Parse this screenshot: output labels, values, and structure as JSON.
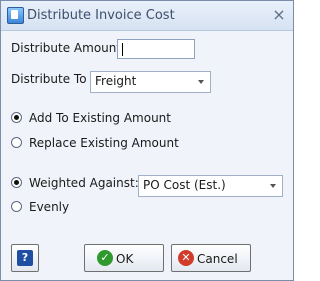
{
  "window": {
    "title": "Distribute Invoice Cost",
    "close_glyph": "×"
  },
  "form": {
    "distribute_amount_label": "Distribute Amount",
    "distribute_amount_value": "",
    "distribute_to_label": "Distribute To",
    "distribute_to_value": "Freight",
    "add_to_existing_label": "Add To Existing Amount",
    "replace_existing_label": "Replace Existing Amount",
    "weighted_against_label": "Weighted Against:",
    "weighted_against_value": "PO Cost (Est.)",
    "evenly_label": "Evenly",
    "selected_mode": "Add To Existing Amount",
    "selected_weighting": "Weighted Against:"
  },
  "buttons": {
    "help_glyph": "?",
    "ok_label": "OK",
    "cancel_label": "Cancel"
  },
  "colors": {
    "ok_icon": "#2e9a2e",
    "cancel_icon": "#d23a2a",
    "help_icon": "#1f4fa3"
  },
  "icons": {
    "app": "document-icon",
    "ok": "check-icon",
    "cancel": "cancel-icon",
    "help": "help-icon",
    "close": "close-icon"
  }
}
